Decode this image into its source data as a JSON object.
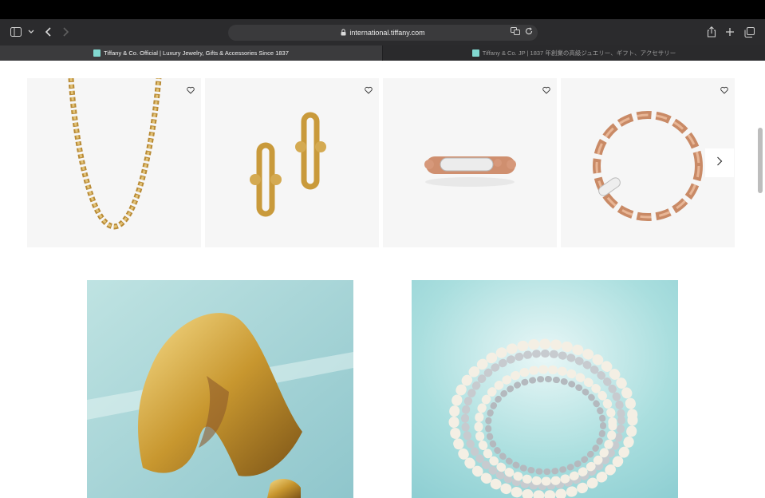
{
  "browser": {
    "url": "international.tiffany.com",
    "tabs": [
      {
        "label": "Tiffany & Co. Official | Luxury Jewelry, Gifts & Accessories Since 1837",
        "active": true
      },
      {
        "label": "Tiffany & Co. JP | 1837 年創業の高級ジュエリー、ギフト、アクセサリー",
        "active": false
      }
    ]
  },
  "carousel": {
    "items": [
      {
        "icon": "chain-necklace"
      },
      {
        "icon": "link-earrings"
      },
      {
        "icon": "diamond-ring"
      },
      {
        "icon": "rose-gold-bracelet"
      }
    ],
    "next_icon": "chevron-right-icon"
  },
  "promos": [
    {
      "icon": "gold-cuff"
    },
    {
      "icon": "pearl-bracelet"
    }
  ],
  "colors": {
    "tiffany_blue": "#81d8d0",
    "gold": "#d4a84a",
    "rose_gold": "#d48f6a"
  }
}
